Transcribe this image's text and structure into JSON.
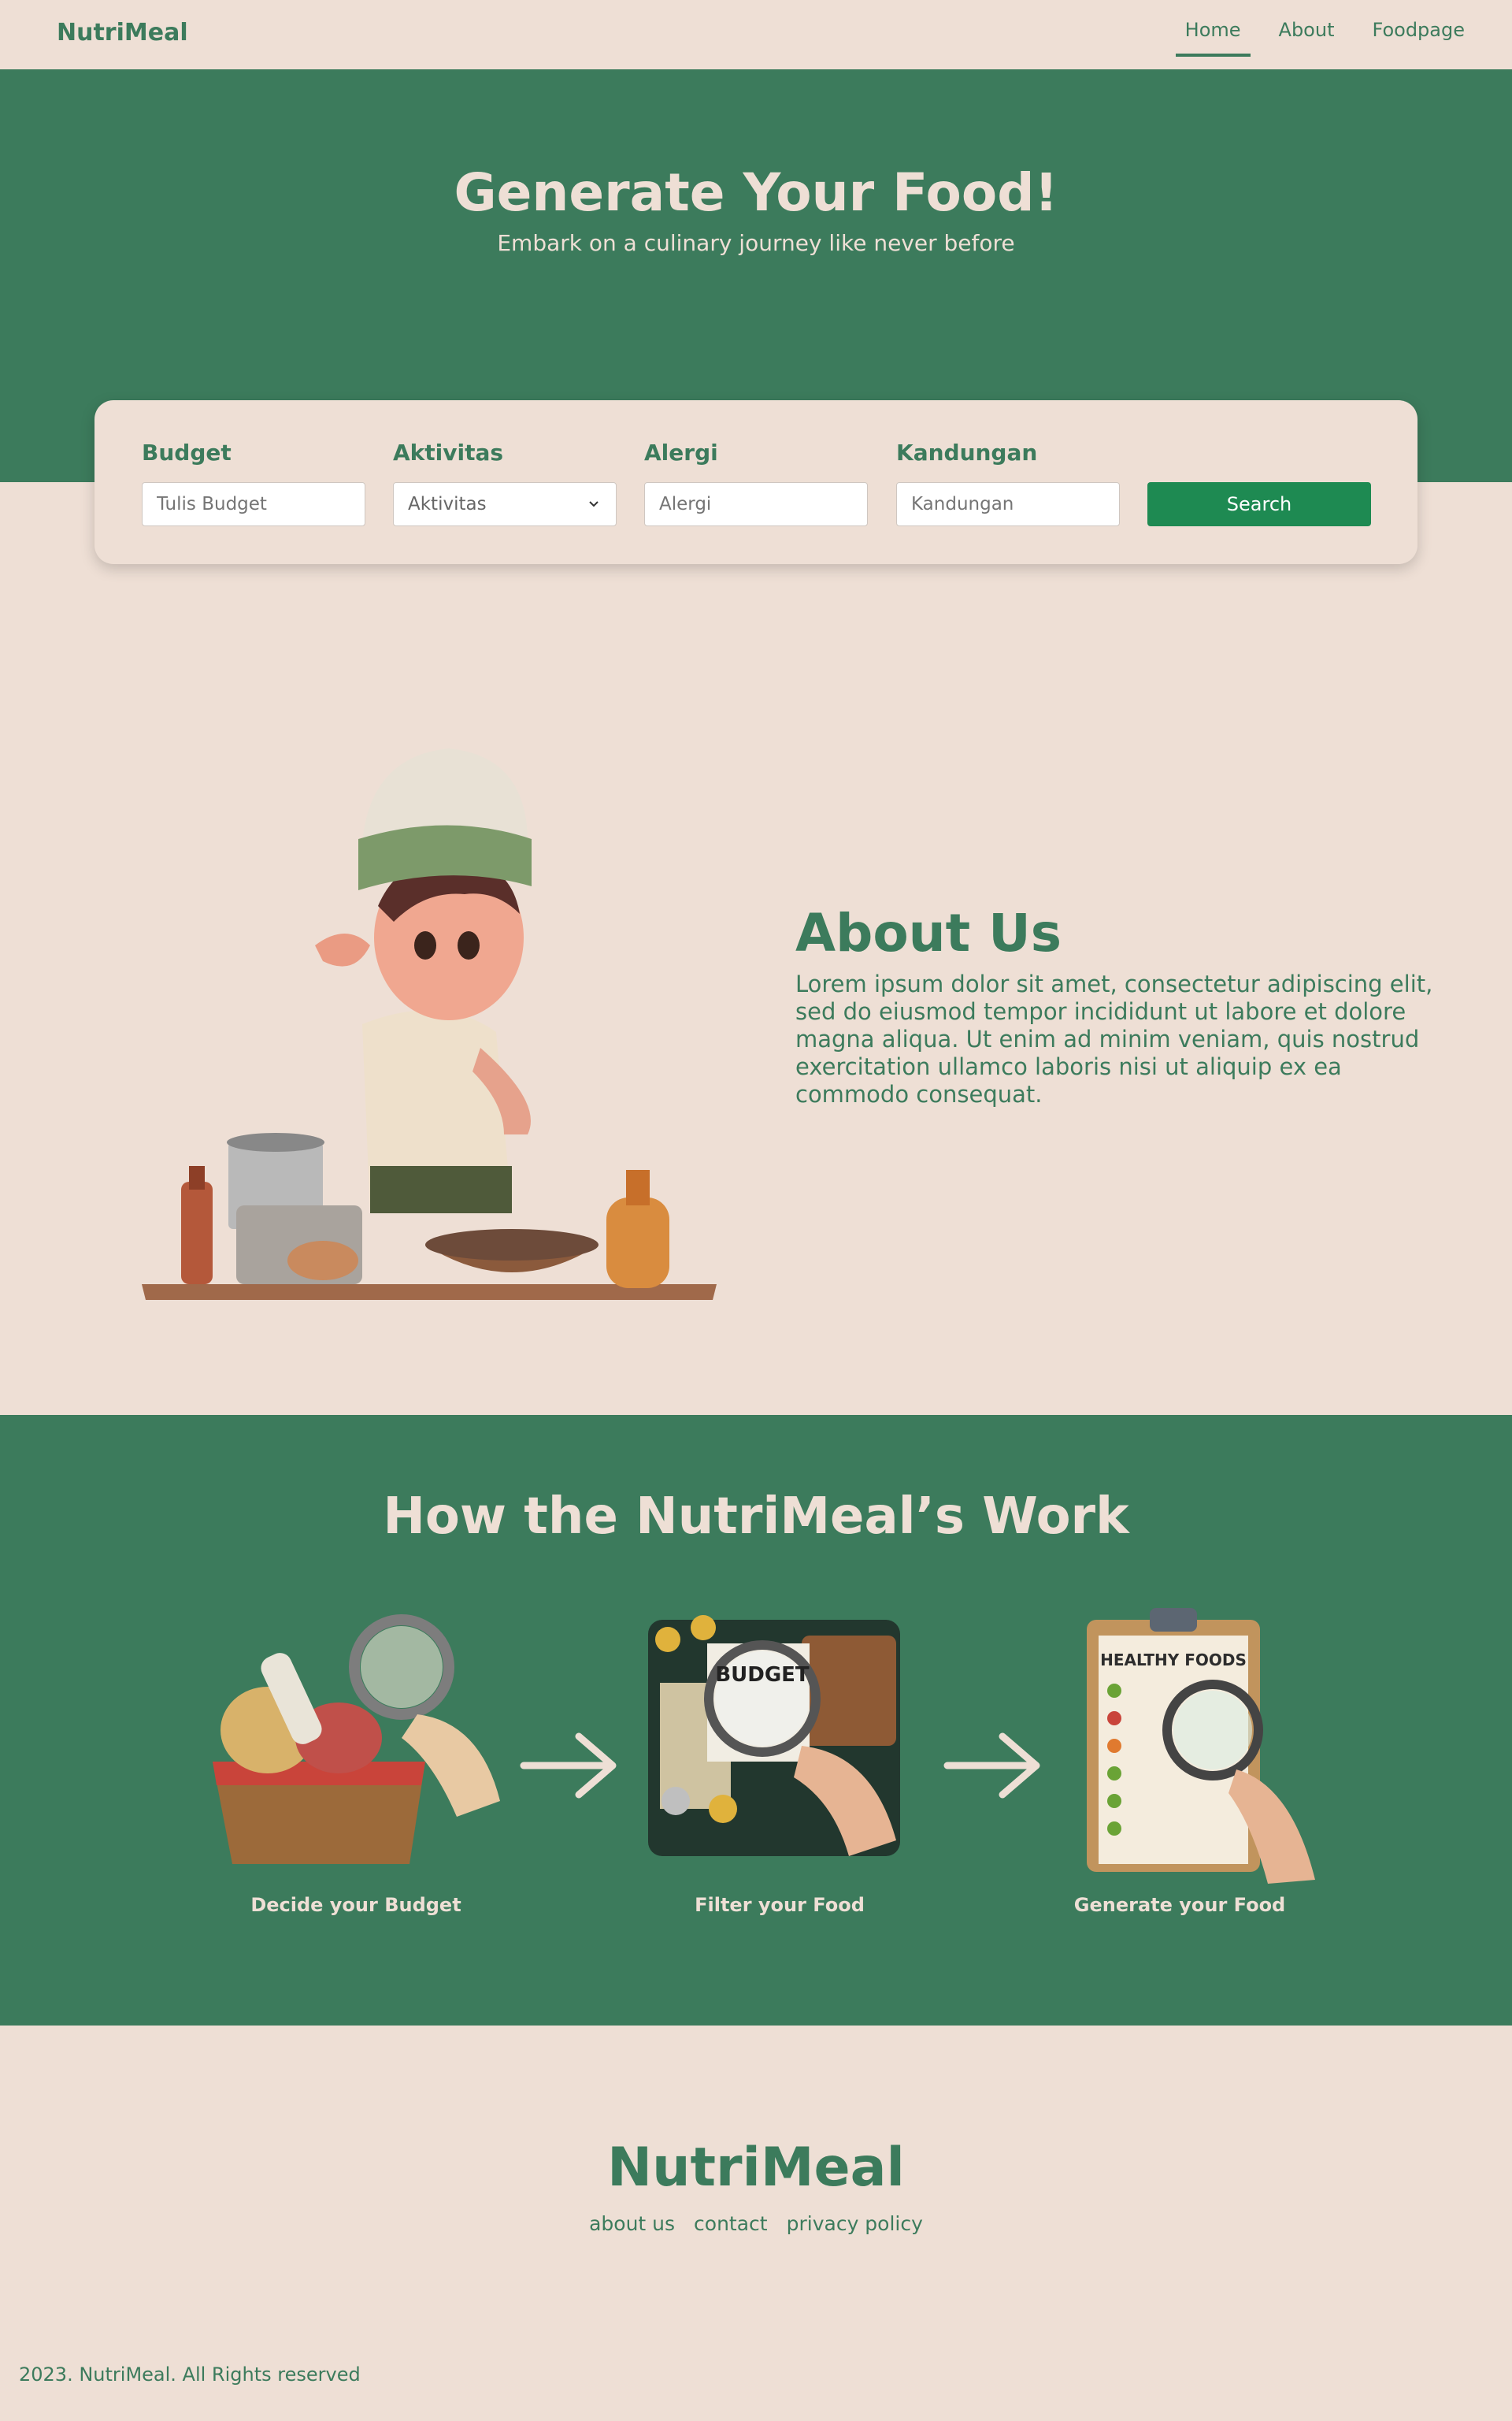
{
  "nav": {
    "brand": "NutriMeal",
    "links": [
      {
        "label": "Home",
        "active": true
      },
      {
        "label": "About",
        "active": false
      },
      {
        "label": "Foodpage",
        "active": false
      }
    ]
  },
  "hero": {
    "title": "Generate Your Food!",
    "subtitle": "Embark on a culinary journey like never before"
  },
  "search": {
    "fields": [
      {
        "label": "Budget",
        "placeholder": "Tulis Budget"
      },
      {
        "label": "Aktivitas",
        "value": "Aktivitas"
      },
      {
        "label": "Alergi",
        "placeholder": "Alergi"
      },
      {
        "label": "Kandungan",
        "placeholder": "Kandungan"
      }
    ],
    "button_label": "Search"
  },
  "about": {
    "title": "About Us",
    "text": "Lorem ipsum dolor sit amet, consectetur adipiscing elit, sed do eiusmod tempor incididunt ut labore et dolore magna aliqua. Ut enim ad minim veniam, quis nostrud exercitation ullamco laboris nisi ut aliquip ex ea commodo consequat."
  },
  "how": {
    "title": "How the NutriMeal’s Work",
    "steps": [
      {
        "label": "Decide your Budget"
      },
      {
        "label": "Filter your Food"
      },
      {
        "label": "Generate your Food"
      }
    ],
    "illustration_text": {
      "budget_sheet_title": "BUDGET",
      "clipboard_title": "HEALTHY FOODS"
    }
  },
  "footer": {
    "brand": "NutriMeal",
    "links": [
      "about us",
      "contact",
      "privacy policy"
    ],
    "copyright": "2023. NutriMeal. All Rights reserved"
  },
  "colors": {
    "background": "#eedfd5",
    "primary_green": "#3c7b5c",
    "button_green": "#1e8a52",
    "cream_text": "#eedfd5"
  }
}
